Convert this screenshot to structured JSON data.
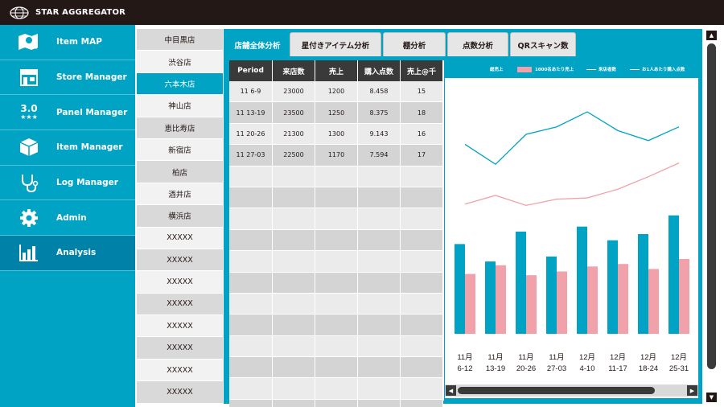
{
  "app": {
    "brand": "STAR AGGREGATOR"
  },
  "sidebar": {
    "items": [
      {
        "label": "Item MAP",
        "icon": "map-search-icon"
      },
      {
        "label": "Store Manager",
        "icon": "store-icon"
      },
      {
        "label": "Panel  Manager",
        "icon": "panel-version-icon",
        "icon_text": "3.0",
        "icon_stars": "★★★"
      },
      {
        "label": "Item Manager",
        "icon": "box-icon"
      },
      {
        "label": "Log Manager",
        "icon": "stethoscope-icon"
      },
      {
        "label": "Admin",
        "icon": "gear-icon"
      },
      {
        "label": "Analysis",
        "icon": "bar-chart-icon",
        "active": true
      }
    ]
  },
  "stores": [
    "中目黒店",
    "渋谷店",
    "六本木店",
    "神山店",
    "恵比寿店",
    "新宿店",
    "柏店",
    "酒井店",
    "横浜店",
    "XXXXX",
    "XXXXX",
    "XXXXX",
    "XXXXX",
    "XXXXX",
    "XXXXX",
    "XXXXX",
    "XXXXX"
  ],
  "active_store_index": 2,
  "tabs": [
    "店舗全体分析",
    "星付きアイテム分析",
    "棚分析",
    "点数分析",
    "QRスキャン数"
  ],
  "active_tab_index": 0,
  "table": {
    "headers": [
      "Period",
      "来店数",
      "売上",
      "購入点数",
      "売上@千"
    ],
    "rows": [
      [
        "11 6-9",
        "23000",
        "1200",
        "8.458",
        "15"
      ],
      [
        "11 13-19",
        "23500",
        "1250",
        "8.375",
        "18"
      ],
      [
        "11 20-26",
        "21300",
        "1300",
        "9.143",
        "16"
      ],
      [
        "11 27-03",
        "22500",
        "1170",
        "7.594",
        "17"
      ]
    ],
    "empty_rows": 12
  },
  "chart_data": {
    "type": "bar",
    "legend_position": "top",
    "legend": [
      "総売上",
      "1000名あたり売上",
      "来店者数",
      "お1人あたり購入点数"
    ],
    "categories": [
      "11月\n6-12",
      "11月\n13-19",
      "11月\n20-26",
      "11月\n27-03",
      "12月\n4-10",
      "12月\n11-17",
      "12月\n18-24",
      "12月\n25-31"
    ],
    "category_lines": [
      [
        "11月",
        "6-12"
      ],
      [
        "11月",
        "13-19"
      ],
      [
        "11月",
        "20-26"
      ],
      [
        "11月",
        "27-03"
      ],
      [
        "12月",
        "4-10"
      ],
      [
        "12月",
        "11-17"
      ],
      [
        "12月",
        "18-24"
      ],
      [
        "12月",
        "25-31"
      ]
    ],
    "series": [
      {
        "name": "総売上",
        "kind": "bar",
        "color": "#00a3c4",
        "values": [
          72,
          58,
          82,
          62,
          86,
          75,
          80,
          95
        ]
      },
      {
        "name": "1000名あたり売上",
        "kind": "bar",
        "color": "#f0a1a9",
        "values": [
          48,
          55,
          47,
          50,
          54,
          56,
          52,
          60
        ]
      },
      {
        "name": "来店者数",
        "kind": "line",
        "color": "#00a3c4",
        "values": [
          152,
          136,
          160,
          166,
          178,
          163,
          155,
          166
        ]
      },
      {
        "name": "お1人あたり購入点数",
        "kind": "line",
        "color": "#f0a1a9",
        "values": [
          104,
          111,
          103,
          108,
          109,
          116,
          126,
          137
        ]
      }
    ],
    "ylim": [
      0,
      200
    ],
    "grid": false
  },
  "colors": {
    "accent": "#00a3c4",
    "dark": "#231815",
    "pink": "#f0a1a9",
    "active_nav": "#0082a8"
  }
}
